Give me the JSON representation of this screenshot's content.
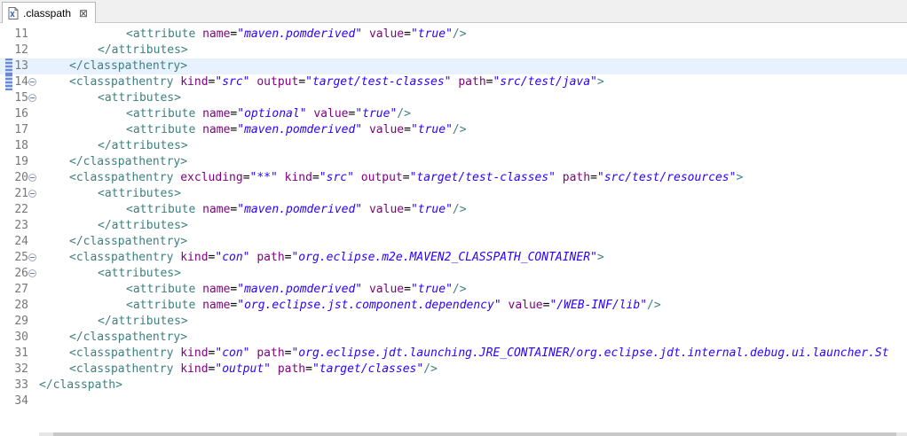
{
  "tab": {
    "title": ".classpath",
    "close_glyph": "⊠",
    "icon": "xml-file-icon"
  },
  "current_line": 13,
  "colors": {
    "tag": "#3f7f7f",
    "attr": "#7f007f",
    "value": "#2a00ff",
    "current_line_bg": "#e8f2fe"
  },
  "lines": [
    {
      "n": "11",
      "fold": false,
      "indent": 2,
      "tokens": [
        [
          "tag",
          "<attribute"
        ],
        [
          "sp",
          " "
        ],
        [
          "attr",
          "name"
        ],
        [
          "eq",
          "="
        ],
        [
          "val",
          "\"maven.pomderived\""
        ],
        [
          "sp",
          " "
        ],
        [
          "attr",
          "value"
        ],
        [
          "eq",
          "="
        ],
        [
          "val",
          "\"true\""
        ],
        [
          "tag",
          "/>"
        ]
      ]
    },
    {
      "n": "12",
      "fold": false,
      "indent": 1,
      "tokens": [
        [
          "tag",
          "</attributes>"
        ]
      ]
    },
    {
      "n": "13",
      "fold": false,
      "indent": 0,
      "tokens": [
        [
          "tag",
          "</classpathentry>"
        ]
      ]
    },
    {
      "n": "14",
      "fold": true,
      "indent": 0,
      "tokens": [
        [
          "tag",
          "<classpathentry"
        ],
        [
          "sp",
          " "
        ],
        [
          "attr",
          "kind"
        ],
        [
          "eq",
          "="
        ],
        [
          "val",
          "\"src\""
        ],
        [
          "sp",
          " "
        ],
        [
          "attr",
          "output"
        ],
        [
          "eq",
          "="
        ],
        [
          "val",
          "\"target/test-classes\""
        ],
        [
          "sp",
          " "
        ],
        [
          "attr",
          "path"
        ],
        [
          "eq",
          "="
        ],
        [
          "val",
          "\"src/test/java\""
        ],
        [
          "tag",
          ">"
        ]
      ]
    },
    {
      "n": "15",
      "fold": true,
      "indent": 1,
      "tokens": [
        [
          "tag",
          "<attributes>"
        ]
      ]
    },
    {
      "n": "16",
      "fold": false,
      "indent": 2,
      "tokens": [
        [
          "tag",
          "<attribute"
        ],
        [
          "sp",
          " "
        ],
        [
          "attr",
          "name"
        ],
        [
          "eq",
          "="
        ],
        [
          "val",
          "\"optional\""
        ],
        [
          "sp",
          " "
        ],
        [
          "attr",
          "value"
        ],
        [
          "eq",
          "="
        ],
        [
          "val",
          "\"true\""
        ],
        [
          "tag",
          "/>"
        ]
      ]
    },
    {
      "n": "17",
      "fold": false,
      "indent": 2,
      "tokens": [
        [
          "tag",
          "<attribute"
        ],
        [
          "sp",
          " "
        ],
        [
          "attr",
          "name"
        ],
        [
          "eq",
          "="
        ],
        [
          "val",
          "\"maven.pomderived\""
        ],
        [
          "sp",
          " "
        ],
        [
          "attr",
          "value"
        ],
        [
          "eq",
          "="
        ],
        [
          "val",
          "\"true\""
        ],
        [
          "tag",
          "/>"
        ]
      ]
    },
    {
      "n": "18",
      "fold": false,
      "indent": 1,
      "tokens": [
        [
          "tag",
          "</attributes>"
        ]
      ]
    },
    {
      "n": "19",
      "fold": false,
      "indent": 0,
      "tokens": [
        [
          "tag",
          "</classpathentry>"
        ]
      ]
    },
    {
      "n": "20",
      "fold": true,
      "indent": 0,
      "tokens": [
        [
          "tag",
          "<classpathentry"
        ],
        [
          "sp",
          " "
        ],
        [
          "attr",
          "excluding"
        ],
        [
          "eq",
          "="
        ],
        [
          "val",
          "\"**\""
        ],
        [
          "sp",
          " "
        ],
        [
          "attr",
          "kind"
        ],
        [
          "eq",
          "="
        ],
        [
          "val",
          "\"src\""
        ],
        [
          "sp",
          " "
        ],
        [
          "attr",
          "output"
        ],
        [
          "eq",
          "="
        ],
        [
          "val",
          "\"target/test-classes\""
        ],
        [
          "sp",
          " "
        ],
        [
          "attr",
          "path"
        ],
        [
          "eq",
          "="
        ],
        [
          "val",
          "\"src/test/resources\""
        ],
        [
          "tag",
          ">"
        ]
      ]
    },
    {
      "n": "21",
      "fold": true,
      "indent": 1,
      "tokens": [
        [
          "tag",
          "<attributes>"
        ]
      ]
    },
    {
      "n": "22",
      "fold": false,
      "indent": 2,
      "tokens": [
        [
          "tag",
          "<attribute"
        ],
        [
          "sp",
          " "
        ],
        [
          "attr",
          "name"
        ],
        [
          "eq",
          "="
        ],
        [
          "val",
          "\"maven.pomderived\""
        ],
        [
          "sp",
          " "
        ],
        [
          "attr",
          "value"
        ],
        [
          "eq",
          "="
        ],
        [
          "val",
          "\"true\""
        ],
        [
          "tag",
          "/>"
        ]
      ]
    },
    {
      "n": "23",
      "fold": false,
      "indent": 1,
      "tokens": [
        [
          "tag",
          "</attributes>"
        ]
      ]
    },
    {
      "n": "24",
      "fold": false,
      "indent": 0,
      "tokens": [
        [
          "tag",
          "</classpathentry>"
        ]
      ]
    },
    {
      "n": "25",
      "fold": true,
      "indent": 0,
      "tokens": [
        [
          "tag",
          "<classpathentry"
        ],
        [
          "sp",
          " "
        ],
        [
          "attr",
          "kind"
        ],
        [
          "eq",
          "="
        ],
        [
          "val",
          "\"con\""
        ],
        [
          "sp",
          " "
        ],
        [
          "attr",
          "path"
        ],
        [
          "eq",
          "="
        ],
        [
          "val",
          "\"org.eclipse.m2e.MAVEN2_CLASSPATH_CONTAINER\""
        ],
        [
          "tag",
          ">"
        ]
      ]
    },
    {
      "n": "26",
      "fold": true,
      "indent": 1,
      "tokens": [
        [
          "tag",
          "<attributes>"
        ]
      ]
    },
    {
      "n": "27",
      "fold": false,
      "indent": 2,
      "tokens": [
        [
          "tag",
          "<attribute"
        ],
        [
          "sp",
          " "
        ],
        [
          "attr",
          "name"
        ],
        [
          "eq",
          "="
        ],
        [
          "val",
          "\"maven.pomderived\""
        ],
        [
          "sp",
          " "
        ],
        [
          "attr",
          "value"
        ],
        [
          "eq",
          "="
        ],
        [
          "val",
          "\"true\""
        ],
        [
          "tag",
          "/>"
        ]
      ]
    },
    {
      "n": "28",
      "fold": false,
      "indent": 2,
      "tokens": [
        [
          "tag",
          "<attribute"
        ],
        [
          "sp",
          " "
        ],
        [
          "attr",
          "name"
        ],
        [
          "eq",
          "="
        ],
        [
          "val",
          "\"org.eclipse.jst.component.dependency\""
        ],
        [
          "sp",
          " "
        ],
        [
          "attr",
          "value"
        ],
        [
          "eq",
          "="
        ],
        [
          "val",
          "\"/WEB-INF/lib\""
        ],
        [
          "tag",
          "/>"
        ]
      ]
    },
    {
      "n": "29",
      "fold": false,
      "indent": 1,
      "tokens": [
        [
          "tag",
          "</attributes>"
        ]
      ]
    },
    {
      "n": "30",
      "fold": false,
      "indent": 0,
      "tokens": [
        [
          "tag",
          "</classpathentry>"
        ]
      ]
    },
    {
      "n": "31",
      "fold": false,
      "indent": 0,
      "tokens": [
        [
          "tag",
          "<classpathentry"
        ],
        [
          "sp",
          " "
        ],
        [
          "attr",
          "kind"
        ],
        [
          "eq",
          "="
        ],
        [
          "val",
          "\"con\""
        ],
        [
          "sp",
          " "
        ],
        [
          "attr",
          "path"
        ],
        [
          "eq",
          "="
        ],
        [
          "val",
          "\"org.eclipse.jdt.launching.JRE_CONTAINER/org.eclipse.jdt.internal.debug.ui.launcher.St"
        ]
      ]
    },
    {
      "n": "32",
      "fold": false,
      "indent": 0,
      "tokens": [
        [
          "tag",
          "<classpathentry"
        ],
        [
          "sp",
          " "
        ],
        [
          "attr",
          "kind"
        ],
        [
          "eq",
          "="
        ],
        [
          "val",
          "\"output\""
        ],
        [
          "sp",
          " "
        ],
        [
          "attr",
          "path"
        ],
        [
          "eq",
          "="
        ],
        [
          "val",
          "\"target/classes\""
        ],
        [
          "tag",
          "/>"
        ]
      ]
    },
    {
      "n": "33",
      "fold": false,
      "indent": -1,
      "tokens": [
        [
          "tag",
          "</classpath>"
        ]
      ]
    },
    {
      "n": "34",
      "fold": false,
      "indent": -1,
      "tokens": []
    }
  ]
}
